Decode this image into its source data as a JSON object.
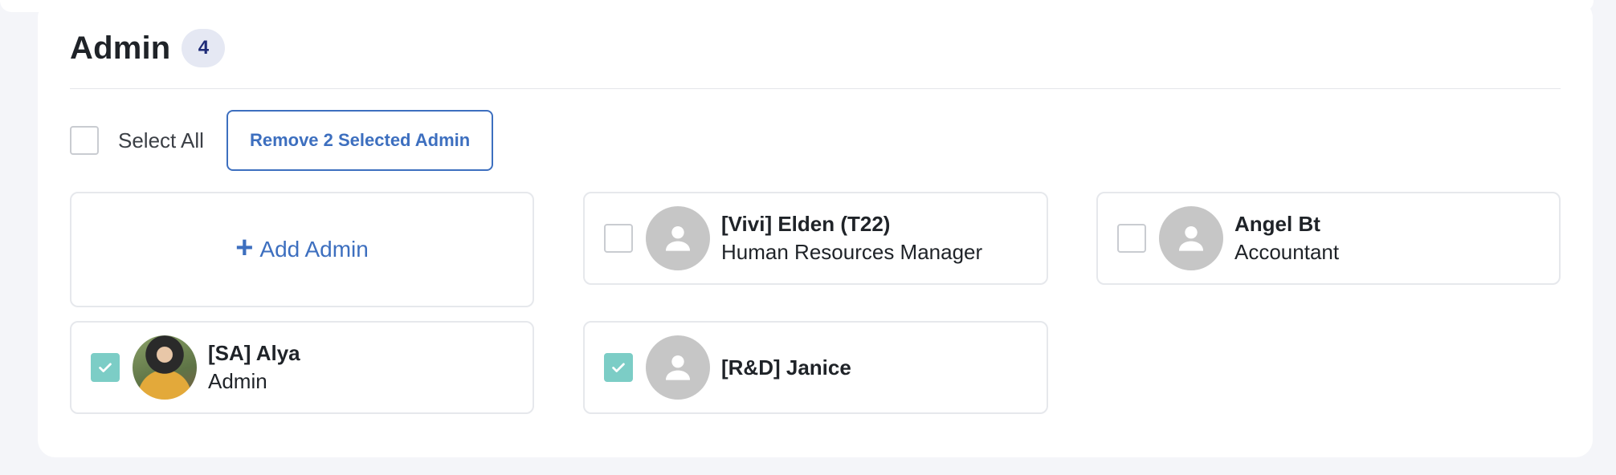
{
  "section": {
    "title": "Admin",
    "count": "4"
  },
  "toolbar": {
    "select_all_label": "Select All",
    "remove_button_label": "Remove 2 Selected Admin"
  },
  "add_tile": {
    "icon": "plus-icon",
    "label": "Add Admin"
  },
  "admins": [
    {
      "name": "[Vivi] Elden (T22)",
      "role": "Human Resources Manager",
      "checked": false,
      "avatar": "default-avatar-icon"
    },
    {
      "name": "Angel Bt",
      "role": "Accountant",
      "checked": false,
      "avatar": "default-avatar-icon"
    },
    {
      "name": "[SA] Alya",
      "role": "Admin",
      "checked": true,
      "avatar": "profile-photo"
    },
    {
      "name": "[R&D] Janice",
      "role": "",
      "checked": true,
      "avatar": "default-avatar-icon"
    }
  ],
  "colors": {
    "accent": "#3d6fbf",
    "checked": "#7ccdc6",
    "badge_bg": "#e5e8f3",
    "badge_text": "#1e2b77",
    "avatar_placeholder": "#c6c6c6"
  }
}
